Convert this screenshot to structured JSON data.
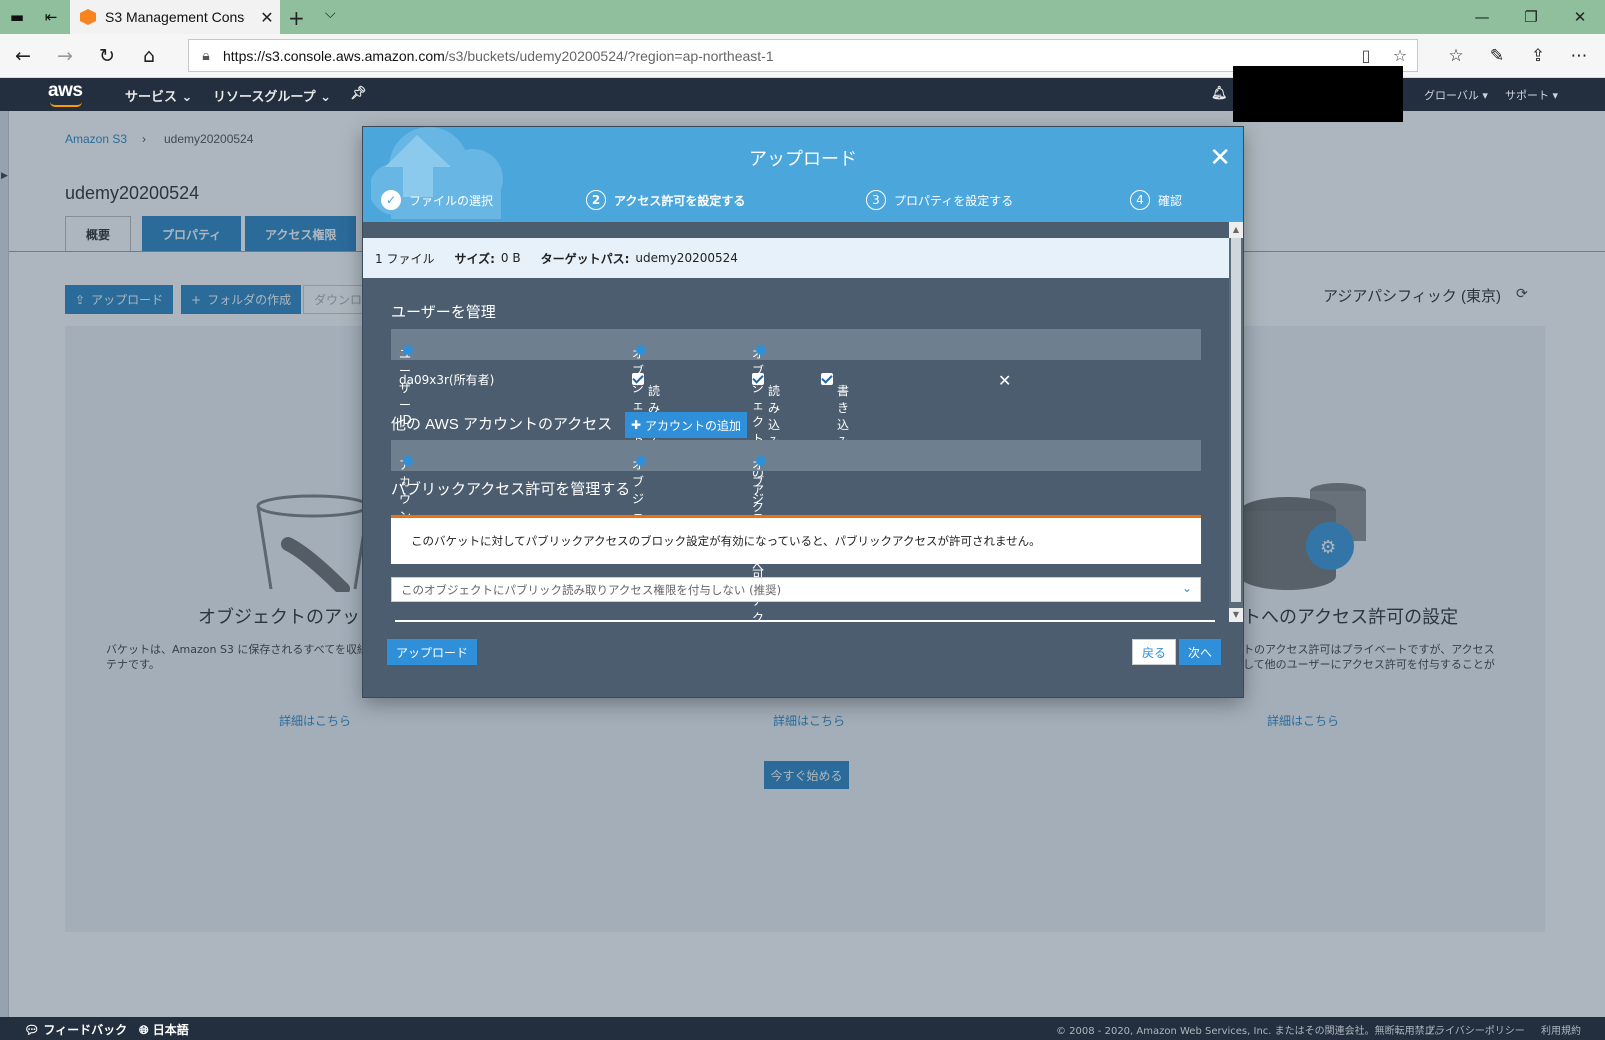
{
  "browser": {
    "tab_title": "S3 Management Conso",
    "url_main": "https://s3.console.aws.amazon.com",
    "url_path": "/s3/buckets/udemy20200524/?region=ap-northeast-1"
  },
  "aws_nav": {
    "logo": "aws",
    "services": "サービス",
    "resource_groups": "リソースグループ",
    "global": "グローバル",
    "support": "サポート"
  },
  "page": {
    "crumb_root": "Amazon S3",
    "crumb_sep": "›",
    "crumb_bucket": "udemy20200524",
    "bucket_title": "udemy20200524",
    "tabs": [
      {
        "label": "概要",
        "active": true
      },
      {
        "label": "プロパティ",
        "active": false
      },
      {
        "label": "アクセス権限",
        "active": false
      }
    ],
    "upload_btn": "アップロード",
    "create_folder_btn": "フォルダの作成",
    "download_btn": "ダウンロ",
    "region": "アジアパシフィック (東京)",
    "feature_left_title": "オブジェクトのアップ",
    "feature_left_desc_1": "バケットは、Amazon S3 に保存されるすべてを収納",
    "feature_left_desc_2": "テナです。",
    "feature_right_title": "トへのアクセス許可の設定",
    "feature_right_desc_1": "トのアクセス許可はプライベートですが、アクセス",
    "feature_right_desc_2": "して他のユーザーにアクセス許可を付与することが",
    "detail_link": "詳細はこちら",
    "start_btn": "今すぐ始める"
  },
  "modal": {
    "title": "アップロード",
    "steps": [
      {
        "num": "✓",
        "label": "ファイルの選択",
        "state": "done"
      },
      {
        "num": "2",
        "label": "アクセス許可を設定する",
        "state": "current"
      },
      {
        "num": "3",
        "label": "プロパティを設定する",
        "state": "pending"
      },
      {
        "num": "4",
        "label": "確認",
        "state": "pending"
      }
    ],
    "info": {
      "files": "1 ファイル",
      "size_label": "サイズ:",
      "size_value": "0 B",
      "target_label": "ターゲットパス:",
      "target_value": "udemy20200524"
    },
    "manage_users_title": "ユーザーを管理",
    "users_table": {
      "col_user_id": "ユーザー ID",
      "col_object": "オブジェクト",
      "col_object_acl": "オブジェクトへのアクセス許可",
      "row_user": "da09x3r(所有者)",
      "row_object_read": "読み込み",
      "row_acl_read": "読み込み",
      "row_acl_write": "書き込み"
    },
    "other_accounts_title": "他の AWS アカウントのアクセス",
    "add_account_btn": "アカウントの追加",
    "accounts_table": {
      "col_account": "アカウント",
      "col_object": "オブジェクト",
      "col_object_acl": "オブジェクトへのアクセス許可"
    },
    "public_title": "パブリックアクセス許可を管理する",
    "warning": "このバケットに対してパブリックアクセスのブロック設定が有効になっていると、パブリックアクセスが許可されません。",
    "public_select": "このオブジェクトにパブリック読み取りアクセス権限を付与しない (推奨)",
    "footer_upload": "アップロード",
    "footer_back": "戻る",
    "footer_next": "次へ"
  },
  "footer": {
    "feedback": "フィードバック",
    "language": "日本語",
    "copyright": "© 2008 - 2020, Amazon Web Services, Inc. またはその関連会社。無断転用禁止。",
    "privacy": "プライバシーポリシー",
    "terms": "利用規約"
  },
  "colors": {
    "modal_header": "#4ba6dc",
    "modal_body": "#4b5d6e",
    "aws_nav": "#232f3e",
    "primary_button": "#2f8fd8",
    "warning_accent": "#ec7211"
  }
}
